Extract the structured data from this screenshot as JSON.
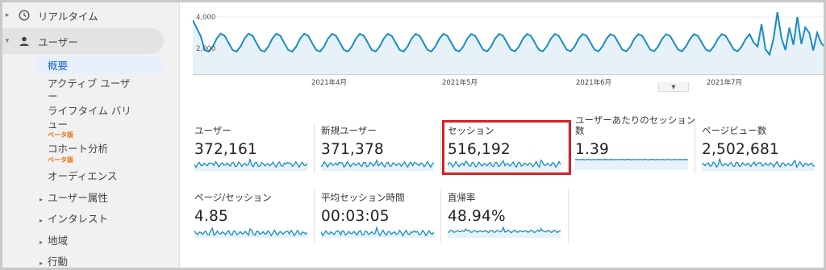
{
  "sidebar": {
    "realtime_label": "リアルタイム",
    "users_label": "ユーザー",
    "sub_items": [
      {
        "label": "概要"
      },
      {
        "label": "アクティブ ユーザ"
      },
      {
        "label": "ー"
      },
      {
        "label": "ライフタイム バリ"
      },
      {
        "label": "ュー"
      },
      {
        "label": "コホート分析"
      },
      {
        "label": "オーディエンス"
      }
    ],
    "beta_badge": "ベータ版",
    "groups": [
      {
        "label": "ユーザー属性"
      },
      {
        "label": "インタレスト"
      },
      {
        "label": "地域"
      },
      {
        "label": "行動"
      }
    ]
  },
  "chart": {
    "y_ticks": [
      "4,000",
      "2,000"
    ],
    "x_ticks": [
      "2021年4月",
      "2021年5月",
      "2021年6月",
      "2021年7月"
    ]
  },
  "metrics": [
    {
      "label": "ユーザー",
      "value": "372,161"
    },
    {
      "label": "新規ユーザー",
      "value": "371,378"
    },
    {
      "label": "セッション",
      "value": "516,192"
    },
    {
      "label": "ユーザーあたりのセッション",
      "label2": "数",
      "value": "1.39"
    },
    {
      "label": "ページビュー数",
      "value": "2,502,681"
    },
    {
      "label": "ページ/セッション",
      "value": "4.85"
    },
    {
      "label": "平均セッション時間",
      "value": "00:03:05"
    },
    {
      "label": "直帰率",
      "value": "48.94%"
    }
  ],
  "colors": {
    "line": "#1a8cc2",
    "fill": "#e6f2f8",
    "highlight_border": "#d0232b",
    "beta": "#e8710a",
    "active_nav": "#1967d2"
  }
}
